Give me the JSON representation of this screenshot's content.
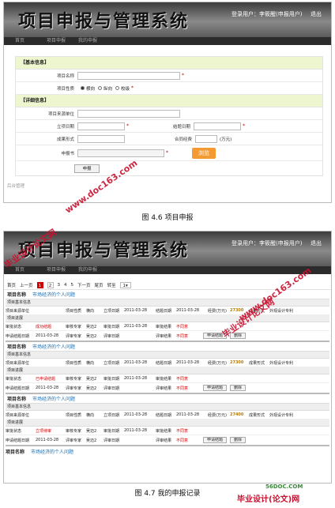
{
  "header": {
    "title": "项目申报与管理系统",
    "user": "登录用户：李筱醒(申报用户)",
    "exit": "退出"
  },
  "nav": [
    "首页",
    "项目申报",
    "我的申报"
  ],
  "form": {
    "sec_basic": "【基本信息】",
    "project_name": "项目名称",
    "project_type": "项目性质",
    "types": [
      "横向",
      "纵向",
      "校级"
    ],
    "sec_detail": "【详细信息】",
    "source": "项目来源单位",
    "start_date": "立项日期",
    "end_date": "结题日期",
    "result_form": "成果形式",
    "contract_funds": "合同经费",
    "unit_wan": "(万元)",
    "apply_doc": "申报书",
    "browse": "浏览",
    "submit": "申报"
  },
  "footer": "后台管理",
  "captions": {
    "fig1": "图 4.6 项目申报",
    "fig2": "图 4.7 我的申报记录"
  },
  "watermarks": {
    "wm1": "毕业设计论文网",
    "wm2": "www.doc163.com",
    "wm3": "56DOC.COM",
    "wm4": "毕业设计(论文)网"
  },
  "pager": {
    "first": "首页",
    "prev": "上一页",
    "pages": [
      "1",
      "2",
      "3",
      "4",
      "5"
    ],
    "next": "下一页",
    "last": "尾页",
    "jump": "转至",
    "select": "1"
  },
  "records": [
    {
      "name_label": "项目名称",
      "name": "市场经济的个人问题",
      "basic": "项目基本信息",
      "source_label": "项目来源单位",
      "type_label": "项目性质",
      "type": "横向",
      "start_label": "立项日期",
      "start": "2011-03-28",
      "end_label": "结题日期",
      "end": "2011-03-28",
      "funds_label": "经费(万元)",
      "funds": "27300",
      "result_label": "成果形式",
      "result": "外观设计专利",
      "progress": "项目进展",
      "audit_label": "审批状态",
      "audit": "成功结题",
      "expert_label": "审核专家",
      "expert": "吴迈2",
      "audit_date_label": "审批日期",
      "audit_date": "2011-03-28",
      "audit_result_label": "审批结果",
      "audit_result": "不同意",
      "apply_label": "申请结题日期",
      "apply_date": "2011-03-28",
      "reviewer_label": "评审专家",
      "reviewer": "吴迈2",
      "review_date_label": "评审日期",
      "review_result_label": "评审结果",
      "review_result": "不同意",
      "btn1": "申请结题",
      "btn2": "删除"
    },
    {
      "name_label": "项目名称",
      "name": "市场经济的个人问题",
      "basic": "项目基本信息",
      "source_label": "项目来源单位",
      "type_label": "项目性质",
      "type": "横向",
      "start_label": "立项日期",
      "start": "2011-03-28",
      "end_label": "结题日期",
      "end": "2011-03-28",
      "funds_label": "经费(万元)",
      "funds": "27300",
      "result_label": "成果形式",
      "result": "外观设计专利",
      "progress": "项目进展",
      "audit_label": "审批状态",
      "audit": "已申请结题",
      "expert_label": "审核专家",
      "expert": "吴迈2",
      "audit_date_label": "审批日期",
      "audit_date": "2011-03-28",
      "audit_result_label": "审批结果",
      "audit_result": "不同意",
      "apply_label": "申请结题日期",
      "apply_date": "2011-03-28",
      "reviewer_label": "评审专家",
      "reviewer": "吴迈2",
      "review_date_label": "评审日期",
      "review_result_label": "评审结果",
      "review_result": "不同意",
      "btn1": "申请结题",
      "btn2": "删除"
    },
    {
      "name_label": "项目名称",
      "name": "市场经济的个人问题",
      "basic": "项目基本信息",
      "source_label": "项目来源单位",
      "type_label": "项目性质",
      "type": "横向",
      "start_label": "立项日期",
      "start": "2011-03-28",
      "end_label": "结题日期",
      "end": "2011-03-28",
      "funds_label": "经费(万元)",
      "funds": "27400",
      "result_label": "成果形式",
      "result": "外观设计专利",
      "progress": "项目进展",
      "audit_label": "审批状态",
      "audit": "立项待审",
      "expert_label": "审核专家",
      "expert": "吴迈2",
      "audit_date_label": "审批日期",
      "audit_date": "2011-03-28",
      "audit_result_label": "审批结果",
      "audit_result": "不同意",
      "apply_label": "申请结题日期",
      "apply_date": "2011-03-28",
      "reviewer_label": "评审专家",
      "reviewer": "吴迈2",
      "review_date_label": "评审日期",
      "review_result_label": "评审结果",
      "review_result": "不同意",
      "btn1": "申请结题",
      "btn2": "删除"
    }
  ],
  "last_record": {
    "name_label": "项目名称",
    "name": "市场经济的个人问题"
  }
}
